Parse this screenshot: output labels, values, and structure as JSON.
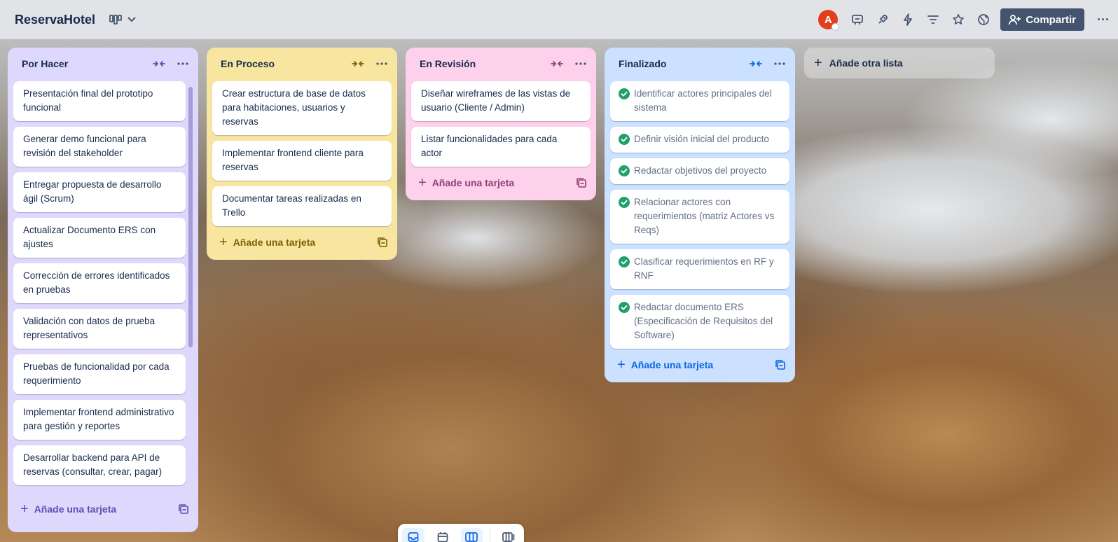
{
  "header": {
    "board_title": "ReservaHotel",
    "view_icon": "board-view-icon",
    "share_label": "Compartir",
    "avatar_initial": "A",
    "icons": [
      "power-ups-icon",
      "automation-icon",
      "filter-icon",
      "star-icon",
      "visibility-icon",
      "more-icon"
    ]
  },
  "lists": [
    {
      "title": "Por Hacer",
      "color": "#dfd8fd",
      "cards": [
        "Presentación final del prototipo funcional",
        "Generar demo funcional para revisión del stakeholder",
        "Entregar propuesta de desarrollo ágil (Scrum)",
        "Actualizar Documento ERS con ajustes",
        "Corrección de errores identificados en pruebas",
        "Validación con datos de prueba representativos",
        "Pruebas de funcionalidad por cada requerimiento",
        "Implementar frontend administrativo para gestión y reportes",
        "Desarrollar backend para API de reservas (consultar, crear, pagar)"
      ],
      "add_label": "Añade una tarjeta"
    },
    {
      "title": "En Proceso",
      "color": "#f8e6a0",
      "cards": [
        "Crear estructura de base de datos para habitaciones, usuarios y reservas",
        "Implementar frontend cliente para reservas",
        "Documentar tareas realizadas en Trello"
      ],
      "add_label": "Añade una tarjeta"
    },
    {
      "title": "En Revisión",
      "color": "#fdd0ec",
      "cards": [
        "Diseñar wireframes de las vistas de usuario (Cliente / Admin)",
        "Listar funcionalidades para cada actor"
      ],
      "add_label": "Añade una tarjeta"
    },
    {
      "title": "Finalizado",
      "color": "#cce0ff",
      "check_color": "#22a06b",
      "cards": [
        "Identificar actores principales del sistema",
        "Definir visión inicial del producto",
        "Redactar objetivos del proyecto",
        "Relacionar actores con requerimientos (matriz Actores vs Reqs)",
        "Clasificar requerimientos en RF y RNF",
        "Redactar documento ERS (Especificación de Requisitos del Software)"
      ],
      "add_label": "Añade una tarjeta"
    }
  ],
  "add_list_label": "Añade otra lista",
  "bottom_bar": {
    "items": [
      "inbox-icon",
      "planner-icon",
      "board-icon",
      "switch-boards-icon"
    ],
    "active": [
      "inbox-icon",
      "board-icon"
    ]
  }
}
